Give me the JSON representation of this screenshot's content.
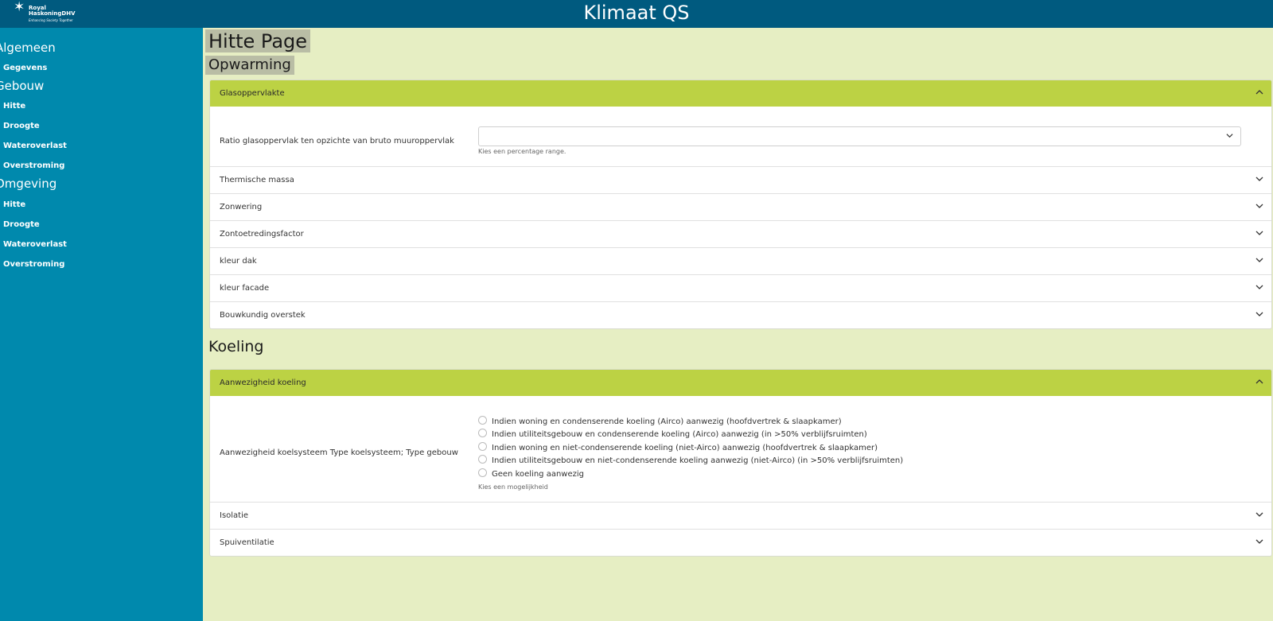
{
  "header": {
    "logo": {
      "line1": "Royal",
      "line2": "HaskoningDHV",
      "tagline": "Enhancing Society Together"
    },
    "title": "Klimaat QS",
    "background": "#005a7f"
  },
  "sidebar": {
    "background": "#0089ad",
    "groups": [
      {
        "title": "Algemeen",
        "items": [
          "Gegevens"
        ]
      },
      {
        "title": "Gebouw",
        "items": [
          "Hitte",
          "Droogte",
          "Wateroverlast",
          "Overstroming"
        ]
      },
      {
        "title": "Omgeving",
        "items": [
          "Hitte",
          "Droogte",
          "Wateroverlast",
          "Overstroming"
        ]
      }
    ]
  },
  "main": {
    "background": "#e6eec3",
    "page_title": "Hitte Page",
    "sections": [
      {
        "title": "Opwarming",
        "accordion": [
          {
            "title": "Glasoppervlakte",
            "expanded": true,
            "field": {
              "label": "Ratio glasoppervlak ten opzichte van bruto muuroppervlak",
              "value": "",
              "hint": "Kies een percentage range."
            }
          },
          {
            "title": "Thermische massa",
            "expanded": false
          },
          {
            "title": "Zonwering",
            "expanded": false
          },
          {
            "title": "Zontoetredingsfactor",
            "expanded": false
          },
          {
            "title": "kleur dak",
            "expanded": false
          },
          {
            "title": "kleur facade",
            "expanded": false
          },
          {
            "title": "Bouwkundig overstek",
            "expanded": false
          }
        ]
      },
      {
        "title": "Koeling",
        "accordion": [
          {
            "title": "Aanwezigheid koeling",
            "expanded": true,
            "field": {
              "label": "Aanwezigheid koelsysteem Type koelsysteem; Type gebouw",
              "options": [
                "Indien woning en condenserende koeling (Airco) aanwezig (hoofdvertrek & slaapkamer)",
                "Indien utiliteitsgebouw en condenserende koeling (Airco) aanwezig (in >50% verblijfsruimten)",
                "Indien woning en niet-condenserende koeling (niet-Airco) aanwezig (hoofdvertrek & slaapkamer)",
                "Indien utiliteitsgebouw en niet-condenserende koeling aanwezig (niet-Airco) (in >50% verblijfsruimten)",
                "Geen koeling aanwezig"
              ],
              "hint": "Kies een mogelijkheid"
            }
          },
          {
            "title": "Isolatie",
            "expanded": false
          },
          {
            "title": "Spuiventilatie",
            "expanded": false
          }
        ]
      }
    ],
    "accent": "#bcd244"
  }
}
